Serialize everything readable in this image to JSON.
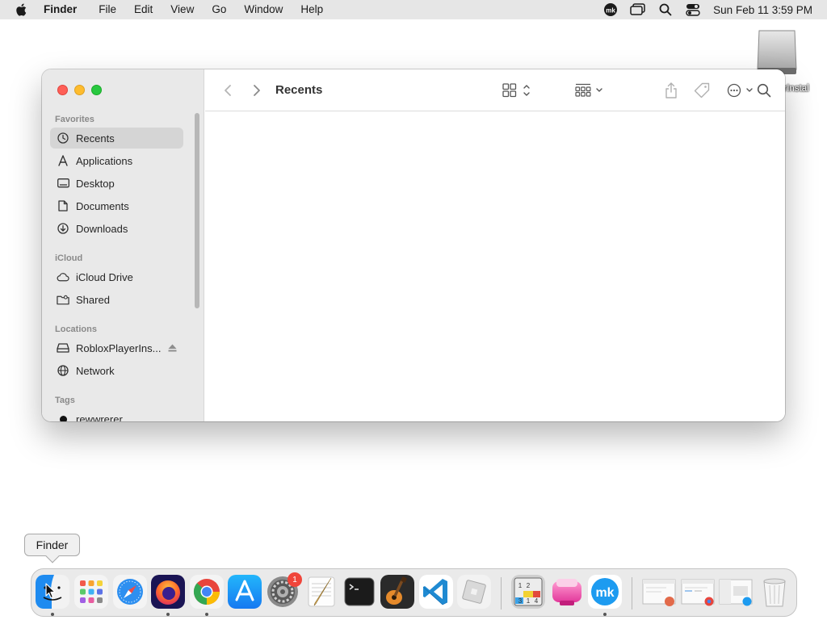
{
  "menubar": {
    "app_name": "Finder",
    "menus": [
      "File",
      "Edit",
      "View",
      "Go",
      "Window",
      "Help"
    ],
    "clock": "Sun Feb 11  3:59 PM"
  },
  "desktop": {
    "disk_label": "erInstal"
  },
  "finder": {
    "title": "Recents",
    "sections": {
      "favorites": "Favorites",
      "icloud": "iCloud",
      "locations": "Locations",
      "tags": "Tags"
    },
    "favorites": [
      {
        "label": "Recents",
        "icon": "clock-icon",
        "selected": true
      },
      {
        "label": "Applications",
        "icon": "applications-icon"
      },
      {
        "label": "Desktop",
        "icon": "desktop-icon"
      },
      {
        "label": "Documents",
        "icon": "document-icon"
      },
      {
        "label": "Downloads",
        "icon": "download-icon"
      }
    ],
    "icloud": [
      {
        "label": "iCloud Drive",
        "icon": "cloud-icon"
      },
      {
        "label": "Shared",
        "icon": "shared-folder-icon"
      }
    ],
    "locations": [
      {
        "label": "RobloxPlayerIns...",
        "icon": "disk-icon"
      },
      {
        "label": "Network",
        "icon": "globe-icon"
      }
    ],
    "tags": [
      {
        "label": "rewwrerer",
        "color": "#111111"
      }
    ]
  },
  "tooltip": "Finder",
  "dock": {
    "apps": [
      "Finder",
      "Launchpad",
      "Safari",
      "Firefox",
      "Chrome",
      "App Store",
      "System Settings",
      "TextEdit",
      "Terminal",
      "GarageBand",
      "Visual Studio Code",
      "Roblox",
      "Sudoku",
      "CleanMyMac",
      "MK",
      "Downloads stack 1",
      "Downloads stack 2",
      "Downloads stack 3",
      "Trash"
    ],
    "settings_badge": "1"
  },
  "colors": {
    "selection": "#d5d5d5",
    "close": "#fe5f57",
    "minimize": "#febc2e",
    "zoom": "#28c840"
  }
}
